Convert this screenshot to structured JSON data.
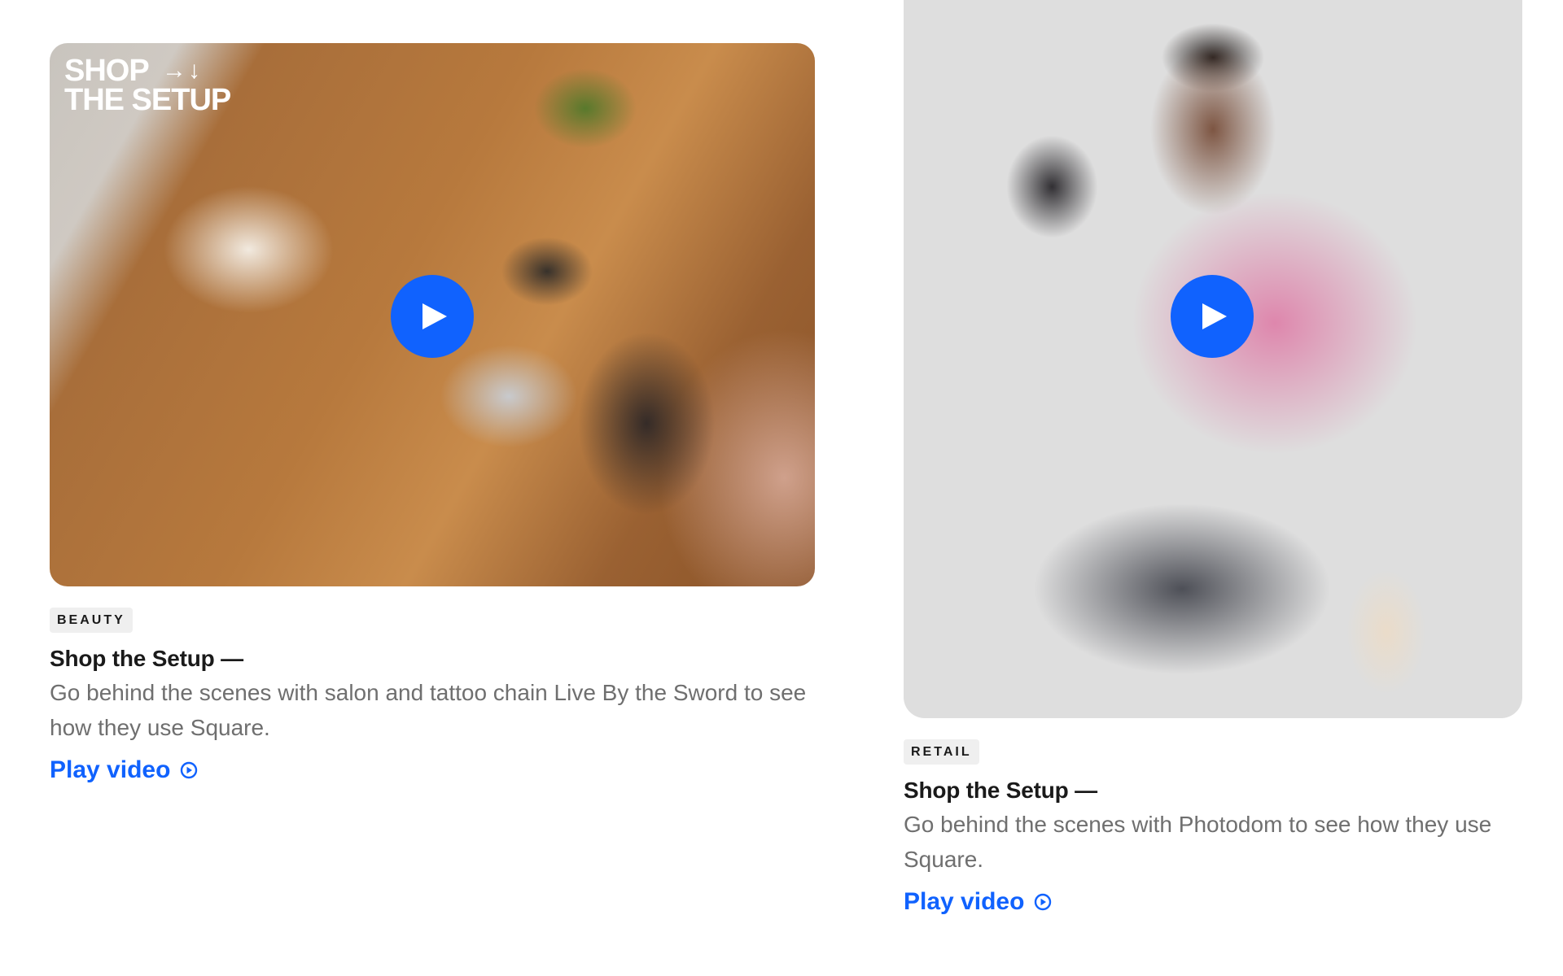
{
  "cards": [
    {
      "stamp": {
        "line1": "SHOP",
        "line2": "THE SETUP",
        "arrows": "→↓"
      },
      "tag": "BEAUTY",
      "title": "Shop the Setup —",
      "description": "Go behind the scenes with salon and tattoo chain Live By the Sword to see how they use Square.",
      "link": "Play video",
      "image": "tattoo-salon-team-at-table-photo"
    },
    {
      "tag": "RETAIL",
      "title": "Shop the Setup —",
      "description": "Go behind the scenes with Photodom to see how they use Square.",
      "link": "Play video",
      "image": "man-holding-instant-camera-photo"
    }
  ],
  "colors": {
    "accent": "#1062fe",
    "tag_bg": "#efefef",
    "body_text": "#6f6f6f"
  },
  "icons": {
    "play": "play-icon",
    "link": "play-circle-icon"
  }
}
